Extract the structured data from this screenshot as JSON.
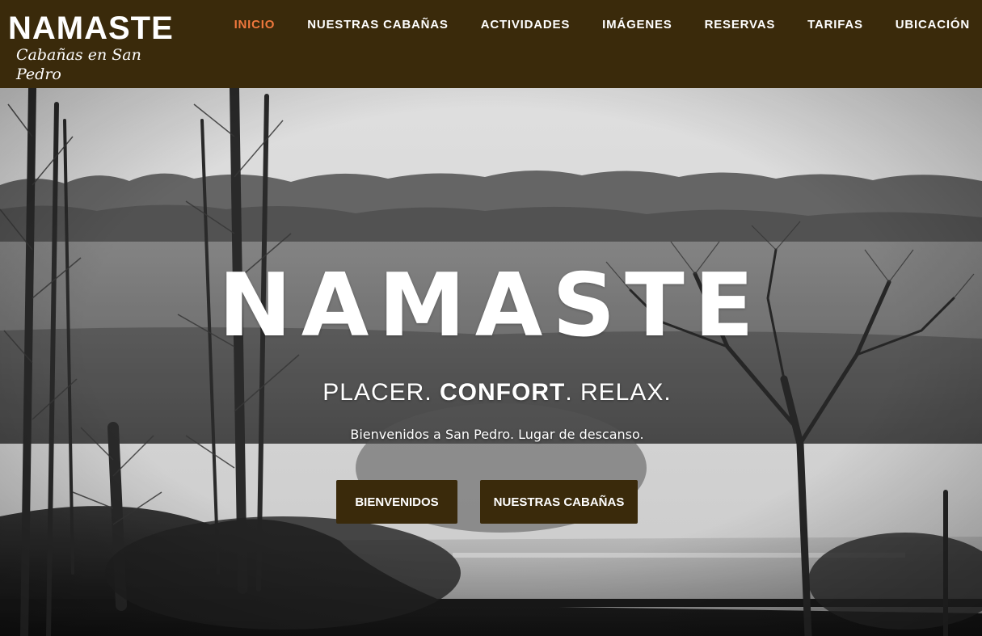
{
  "brand": {
    "title": "NAMASTE",
    "subtitle": "Cabañas en San Pedro"
  },
  "nav": {
    "items": [
      {
        "label": "INICIO",
        "active": true
      },
      {
        "label": "NUESTRAS CABAÑAS",
        "active": false
      },
      {
        "label": "ACTIVIDADES",
        "active": false
      },
      {
        "label": "IMÁGENES",
        "active": false
      },
      {
        "label": "RESERVAS",
        "active": false
      },
      {
        "label": "TARIFAS",
        "active": false
      },
      {
        "label": "UBICACIÓN",
        "active": false
      }
    ]
  },
  "hero": {
    "title": "NAMASTE",
    "tagline": {
      "part1": "PLACER. ",
      "part2": "CONFORT",
      "part3": ". RELAX."
    },
    "welcome": "Bienvenidos a San Pedro. Lugar de descanso.",
    "buttons": {
      "primary": "BIENVENIDOS",
      "secondary": "NUESTRAS CABAÑAS"
    }
  },
  "colors": {
    "header_bg": "#3a2a0b",
    "nav_active": "#f0783d",
    "button_bg": "#3a2a0b",
    "text": "#ffffff"
  }
}
